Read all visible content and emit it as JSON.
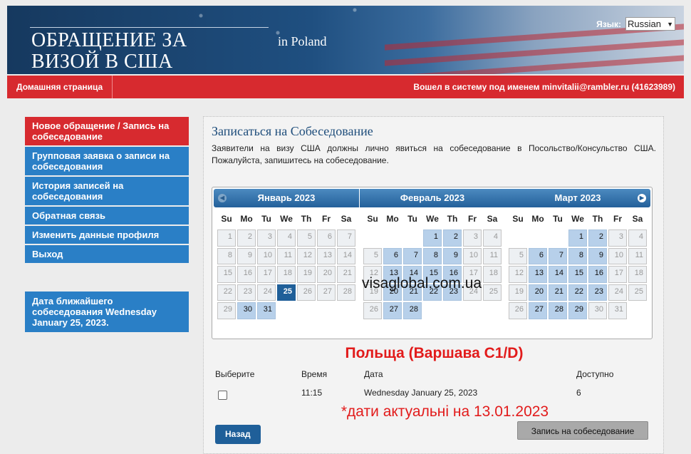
{
  "header": {
    "title_line1": "ОБРАЩЕНИЕ ЗА",
    "title_line2": "ВИЗОЙ В США",
    "location": "in  Poland",
    "lang_label": "Язык:",
    "lang_value": "Russian"
  },
  "nav": {
    "home": "Домашняя страница",
    "login": "Вошел в систему под именем  minvitalii@rambler.ru (41623989)"
  },
  "sidebar": {
    "items": [
      {
        "label": "Новое обращение / Запись на собеседование"
      },
      {
        "label": "Групповая заявка о записи на собеседования"
      },
      {
        "label": "История записей на собеседования"
      },
      {
        "label": "Обратная связь"
      },
      {
        "label": "Изменить данные профиля"
      },
      {
        "label": "Выход"
      }
    ],
    "next_appointment": "Дата ближайшего собеседования Wednesday January 25, 2023."
  },
  "main": {
    "title": "Записаться на Собеседование",
    "description": "Заявители на визу США должны лично явиться на собеседование в Посольство/Консульство США. Пожалуйста, запишитесь на собеседование.",
    "watermark": "visaglobal.com.ua",
    "city": "Польща (Варшава C1/D)",
    "note": "*дати актуальні на 13.01.2023",
    "table": {
      "headers": [
        "Выберите",
        "Время",
        "Дата",
        "Доступно"
      ],
      "row": {
        "time": "11:15",
        "date": "Wednesday January 25, 2023",
        "available": "6"
      }
    },
    "back_button": "Назад",
    "book_button": "Запись на собеседование"
  },
  "calendar": {
    "weekdays": [
      "Su",
      "Mo",
      "Tu",
      "We",
      "Th",
      "Fr",
      "Sa"
    ],
    "months": [
      {
        "name": "Январь 2023",
        "offset": 0,
        "days": 31,
        "available": [
          30,
          31
        ],
        "selected": 25
      },
      {
        "name": "Февраль 2023",
        "offset": 3,
        "days": 28,
        "available": [
          1,
          2,
          6,
          7,
          8,
          9,
          13,
          14,
          15,
          16,
          20,
          21,
          22,
          23,
          27,
          28
        ],
        "selected": null
      },
      {
        "name": "Март 2023",
        "offset": 3,
        "days": 31,
        "available": [
          1,
          2,
          6,
          7,
          8,
          9,
          13,
          14,
          15,
          16,
          20,
          21,
          22,
          23,
          27,
          28,
          29
        ],
        "selected": null
      }
    ]
  }
}
